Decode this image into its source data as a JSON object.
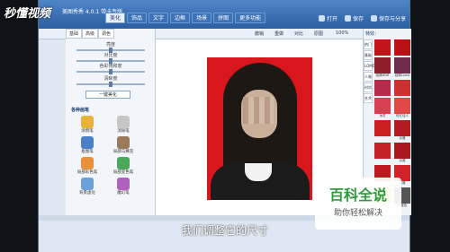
{
  "overlay": {
    "logo": "秒懂视频",
    "subtitle": "我们调整它的尺寸"
  },
  "watermark": {
    "title": "百科全说",
    "subtitle": "助你轻松解决"
  },
  "app": {
    "title": "美图秀秀 4.0.1 带卡专版",
    "tabs": [
      {
        "label": "美化",
        "active": true
      },
      {
        "label": "饰品"
      },
      {
        "label": "文字"
      },
      {
        "label": "边框"
      },
      {
        "label": "场景"
      },
      {
        "label": "拼图"
      },
      {
        "label": "更多功能"
      }
    ],
    "right_buttons": [
      {
        "label": "打开",
        "icon": "folder-icon"
      },
      {
        "label": "保存",
        "icon": "save-icon"
      },
      {
        "label": "保存与分享",
        "icon": "share-icon"
      }
    ],
    "toolbar": {
      "items": [
        "撤销",
        "重做",
        "对比",
        "原图",
        "100%"
      ]
    }
  },
  "left_panel": {
    "tabs": [
      "基础",
      "高级",
      "调色"
    ],
    "sliders": [
      {
        "label": "亮度"
      },
      {
        "label": "对比度"
      },
      {
        "label": "色彩饱和度"
      },
      {
        "label": "清晰度"
      }
    ],
    "one_key_label": "一键美化",
    "section_title": "各种画笔",
    "tools": [
      {
        "label": "涂鸦笔",
        "color": "#e9b23a"
      },
      {
        "label": "消除笔",
        "color": "#c6c6c6"
      },
      {
        "label": "抠图笔",
        "color": "#4a7fc8"
      },
      {
        "label": "局部马赛克",
        "color": "#9a7a5a"
      },
      {
        "label": "局部彩色笔",
        "color": "#e9903a"
      },
      {
        "label": "局部变色笔",
        "color": "#4aa85a"
      },
      {
        "label": "背景虚化",
        "color": "#6aa0d8"
      },
      {
        "label": "魔幻笔",
        "color": "#b060c0"
      }
    ]
  },
  "right_panel": {
    "header": "特效：",
    "side_tabs": [
      "热门",
      "基础",
      "LOMO",
      "人像",
      "时尚",
      "艺术"
    ],
    "thumbs": [
      {
        "label": ""
      },
      {
        "label": ""
      },
      {
        "label": "经典HDR"
      },
      {
        "label": "经典Lomo"
      },
      {
        "label": ""
      },
      {
        "label": ""
      },
      {
        "label": "冰灵"
      },
      {
        "label": "时红佳人"
      },
      {
        "label": ""
      },
      {
        "label": "淡雅"
      },
      {
        "label": ""
      },
      {
        "label": "淡雅"
      },
      {
        "label": ""
      },
      {
        "label": "淡雅"
      },
      {
        "label": "自然"
      },
      {
        "label": "阿宝色"
      }
    ]
  }
}
